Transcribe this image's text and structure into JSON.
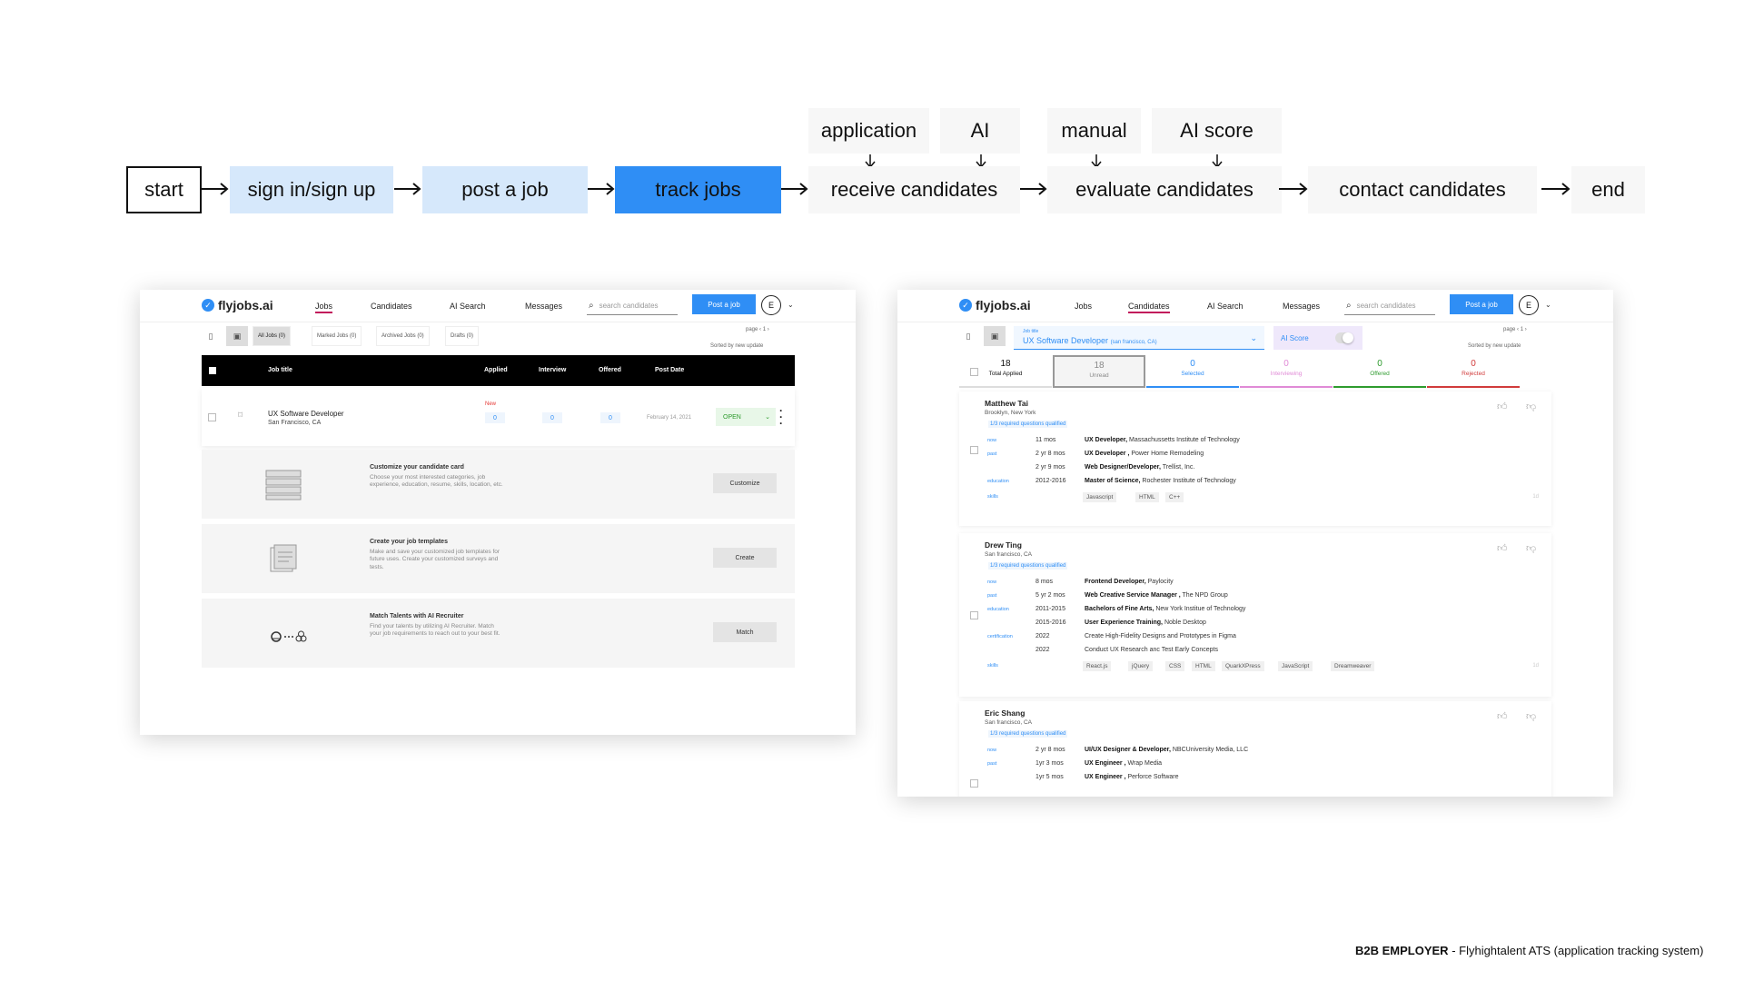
{
  "flow": {
    "start": "start",
    "signin": "sign in/sign up",
    "post": "post a job",
    "track": "track jobs",
    "receive": "receive candidates",
    "evaluate": "evaluate candidates",
    "contact": "contact candidates",
    "end": "end",
    "sub_application": "application",
    "sub_ai": "AI",
    "sub_manual": "manual",
    "sub_ai_score": "AI score"
  },
  "left": {
    "logo": "flyjobs.ai",
    "nav": {
      "jobs": "Jobs",
      "candidates": "Candidates",
      "ai_search": "AI Search",
      "messages": "Messages"
    },
    "search_placeholder": "search candidates",
    "post_button": "Post a job",
    "avatar": "E",
    "tabs": {
      "all": "All Jobs (0)",
      "marked": "Marked Jobs (0)",
      "archived": "Archived Jobs (0)",
      "drafts": "Drafts (0)"
    },
    "page_label": "page",
    "page_number": "1",
    "sort_label": "Sorted by new update",
    "table_head": {
      "title": "Job title",
      "applied": "Applied",
      "interview": "Interview",
      "offered": "Offered",
      "post_date": "Post Date"
    },
    "job": {
      "title": "UX Software Developer",
      "location": "San Francisco, CA",
      "new_badge": "New",
      "applied": "0",
      "interview": "0",
      "offered": "0",
      "date": "February 14, 2021",
      "status": "OPEN"
    },
    "promos": [
      {
        "title": "Customize your candidate card",
        "desc": "Choose your most interested categories, job experience, education, resume, skills, location, etc.",
        "button": "Customize"
      },
      {
        "title": "Create your job templates",
        "desc": "Make and save your customized job templates for future uses. Create your customized surveys and tests.",
        "button": "Create"
      },
      {
        "title": "Match Talents with AI Recruiter",
        "desc": "Find your talents by utilizing AI Recruiter. Match your job requirements to reach out to your best fit.",
        "button": "Match"
      }
    ]
  },
  "right": {
    "logo": "flyjobs.ai",
    "nav": {
      "jobs": "Jobs",
      "candidates": "Candidates",
      "ai_search": "AI Search",
      "messages": "Messages"
    },
    "search_placeholder": "search candidates",
    "post_button": "Post a job",
    "avatar": "E",
    "job_select_label": "Job title",
    "job_select_value": "UX Software Developer",
    "job_select_loc": "(san francisco, CA)",
    "ai_score": "AI Score",
    "page_label": "page",
    "page_number": "1",
    "sort_label": "Sorted by new update",
    "stats": [
      {
        "num": "18",
        "label": "Total Applied",
        "color": "#111111",
        "border": "#dddddd"
      },
      {
        "num": "18",
        "label": "Unread",
        "color": "#888888",
        "border": "#888888"
      },
      {
        "num": "0",
        "label": "Selected",
        "color": "#2f8ef5",
        "border": "#2f8ef5"
      },
      {
        "num": "0",
        "label": "Interviewing",
        "color": "#e08ad6",
        "border": "#e08ad6"
      },
      {
        "num": "0",
        "label": "Offered",
        "color": "#2e9b2e",
        "border": "#2e9b2e"
      },
      {
        "num": "0",
        "label": "Rejected",
        "color": "#d13b3b",
        "border": "#d13b3b"
      }
    ],
    "candidates": [
      {
        "name": "Matthew Tai",
        "location": "Brooklyn, New York",
        "qualified": "1/3 required questions qualified",
        "ago": "1d",
        "rows": [
          {
            "tag": "now",
            "dur": "11 mos",
            "role": "UX Developer,",
            "org": "Massachussetts Institute of Technology"
          },
          {
            "tag": "past",
            "dur": "2 yr 8 mos",
            "role": "UX Developer ,",
            "org": "Power Home Remodeling"
          },
          {
            "tag": "",
            "dur": "2 yr 9 mos",
            "role": "Web Designer/Developer,",
            "org": "Trellist, Inc."
          },
          {
            "tag": "education",
            "dur": "2012-2016",
            "role": "Master of Science,",
            "org": "Rochester Institute of Technology"
          }
        ],
        "skills_tag": "skills",
        "skills": [
          "Javascript",
          "HTML",
          "C++"
        ]
      },
      {
        "name": "Drew Ting",
        "location": "San francisco, CA",
        "qualified": "1/3 required questions qualified",
        "ago": "1d",
        "rows": [
          {
            "tag": "now",
            "dur": "8 mos",
            "role": "Frontend Developer,",
            "org": "Paylocity"
          },
          {
            "tag": "past",
            "dur": "5 yr 2 mos",
            "role": "Web Creative Service Manager ,",
            "org": "The NPD Group"
          },
          {
            "tag": "education",
            "dur": "2011-2015",
            "role": "Bachelors of Fine Arts,",
            "org": "New York Institue of Technology"
          },
          {
            "tag": "",
            "dur": "2015-2016",
            "role": "User Experience Training,",
            "org": "Noble Desktop"
          },
          {
            "tag": "certification",
            "dur": "2022",
            "role": "",
            "org": "Create High-Fidelity Designs and Prototypes in Figma"
          },
          {
            "tag": "",
            "dur": "2022",
            "role": "",
            "org": "Conduct UX Research anc Test Early Concepts"
          }
        ],
        "skills_tag": "skills",
        "skills": [
          "React.js",
          "jQuery",
          "CSS",
          "HTML",
          "QuarkXPress",
          "JavaScript",
          "Dreamweaver"
        ]
      },
      {
        "name": "Eric Shang",
        "location": "San francisco, CA",
        "qualified": "1/3 required questions qualified",
        "ago": "",
        "rows": [
          {
            "tag": "now",
            "dur": "2 yr 8 mos",
            "role": "UI/UX Designer & Developer,",
            "org": "NBCUniversity Media, LLC"
          },
          {
            "tag": "past",
            "dur": "1yr 3 mos",
            "role": "UX Engineer ,",
            "org": "Wrap Media"
          },
          {
            "tag": "",
            "dur": "1yr 5 mos",
            "role": "UX Engineer ,",
            "org": "Perforce Software"
          }
        ],
        "skills_tag": "",
        "skills": []
      }
    ]
  },
  "caption": {
    "bold": "B2B EMPLOYER",
    "rest": " - Flyhightalent ATS (application tracking system)"
  }
}
